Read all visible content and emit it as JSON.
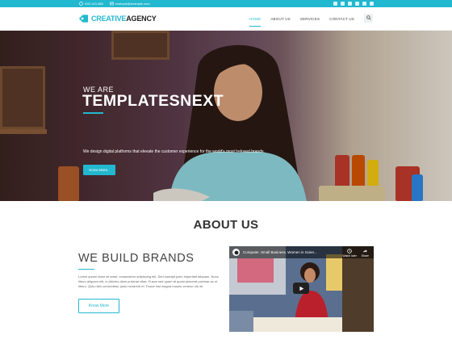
{
  "topbar": {
    "phone": "000-123-456",
    "email": "example@example.com",
    "social_icons": [
      "twitter-icon",
      "facebook-icon",
      "google-plus-icon",
      "linkedin-icon",
      "youtube-icon",
      "instagram-icon"
    ]
  },
  "header": {
    "logo_part1": "CREATIVE",
    "logo_part2": "AGENCY",
    "nav": [
      {
        "label": "HOME",
        "active": true
      },
      {
        "label": "ABOUT US",
        "active": false
      },
      {
        "label": "SERVICES",
        "active": false
      },
      {
        "label": "CONTACT US",
        "active": false
      }
    ]
  },
  "hero": {
    "kicker": "WE ARE",
    "title": "TEMPLATESNEXT",
    "description": "We design digital platforms that elevate the customer experience for the world's most beloved brands.",
    "button": "Know More.."
  },
  "about": {
    "title": "ABOUT US",
    "heading": "WE BUILD BRANDS",
    "body": "Lorem ipsum dolor sit amet, consectetur adipiscing elit. Sed suscipit justo imperdiet aliquam. Nunc libero aliquam elit, a ultricies diam pulvinar vitae. Fusce sed quam at quam placerat pulvinar ac ut libero. Quis nibh consectetur justo hendrerit et. Fusce nisl magna mauris veneno nis mi.",
    "button": "Know More"
  },
  "video": {
    "title": "Computer. Small Business, Women in Scien...",
    "watch_later": "Watch later",
    "share": "Share"
  },
  "colors": {
    "accent": "#22b8cf",
    "text_dark": "#333333"
  }
}
